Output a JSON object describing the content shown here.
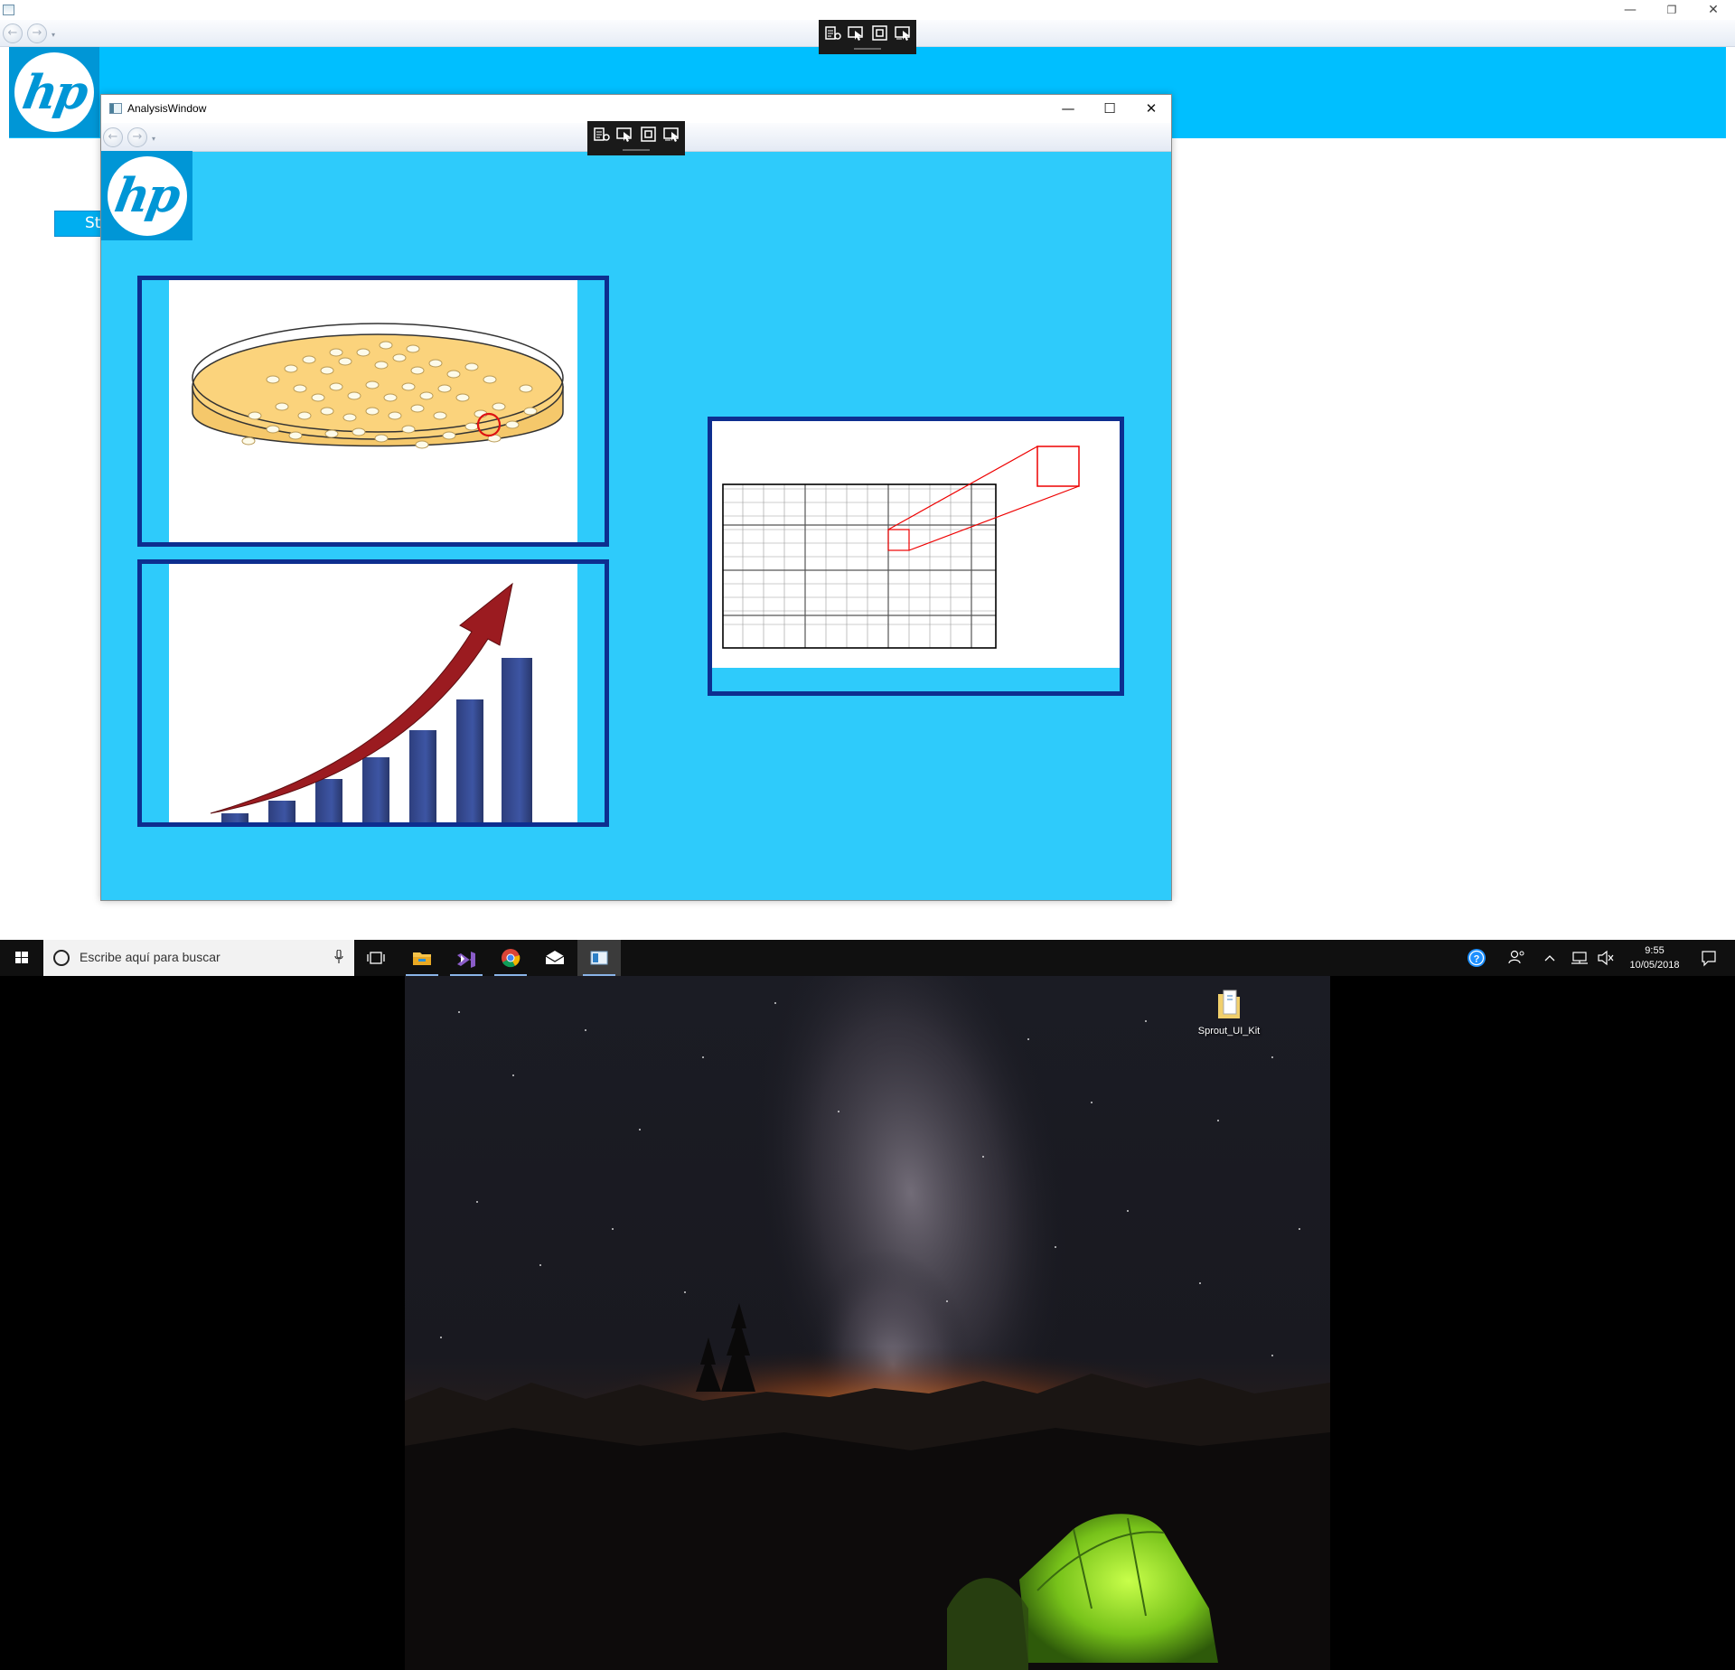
{
  "main_window": {
    "logo_text": "hp",
    "start_button_label": "St",
    "controls": {
      "minimize": "—",
      "restore": "❐",
      "close": "✕"
    }
  },
  "analysis_window": {
    "title": "AnalysisWindow",
    "logo_text": "hp",
    "controls": {
      "minimize": "—",
      "maximize": "☐",
      "close": "✕"
    },
    "panels": [
      {
        "name": "petri-dish",
        "icon": "petri-dish-image"
      },
      {
        "name": "growth-chart",
        "icon": "bar-chart-arrow-image"
      },
      {
        "name": "grid-zoom",
        "icon": "grid-zoom-image"
      }
    ]
  },
  "floating_toolbar": {
    "tools": [
      "select-visual-tree-icon",
      "select-element-icon",
      "display-layout-adorners-icon",
      "track-focused-element-icon"
    ]
  },
  "taskbar": {
    "search_placeholder": "Escribe aquí para buscar",
    "apps": [
      "task-view",
      "file-explorer",
      "visual-studio",
      "chrome",
      "mail",
      "sprout-app"
    ],
    "clock_time": "9:55",
    "clock_date": "10/05/2018"
  },
  "desktop": {
    "icons": [
      {
        "label": "Sprout_UI_Kit"
      }
    ]
  },
  "colors": {
    "banner": "#00bfff",
    "window_bg": "#2ecbfb",
    "panel_border": "#0d2e8f",
    "hp_blue": "#0096d6"
  }
}
